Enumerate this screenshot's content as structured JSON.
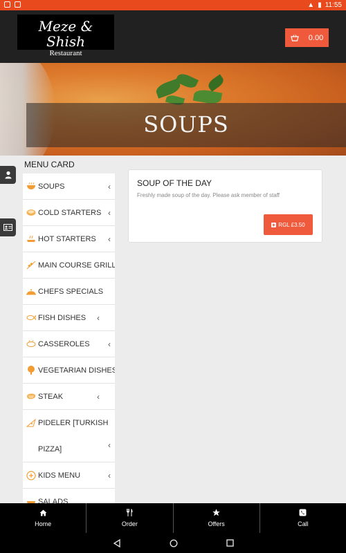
{
  "status": {
    "time": "11:55"
  },
  "header": {
    "logo_line1": "Meze & Shish",
    "logo_line2": "Restaurant",
    "cart_total": "0.00"
  },
  "banner": {
    "title": "SOUPS"
  },
  "menu": {
    "title": "MENU CARD",
    "items": [
      {
        "label": "SOUPS",
        "icon": "bowl-icon"
      },
      {
        "label": "COLD STARTERS",
        "icon": "bowl-icon"
      },
      {
        "label": "HOT STARTERS",
        "icon": "hot-dish-icon"
      },
      {
        "label": "MAIN COURSE GRILL",
        "icon": "skewer-icon"
      },
      {
        "label": "CHEFS SPECIALS",
        "icon": "cloche-icon"
      },
      {
        "label": "FISH DISHES",
        "icon": "fish-icon"
      },
      {
        "label": "CASSEROLES",
        "icon": "casserole-icon"
      },
      {
        "label": "VEGETARIAN DISHES",
        "icon": "broccoli-icon"
      },
      {
        "label": "STEAK",
        "icon": "steak-icon"
      },
      {
        "label": "PIDELER [TURKISH PIZZA]",
        "icon": "pizza-icon"
      },
      {
        "label": "KIDS MENU",
        "icon": "plus-circle-icon"
      },
      {
        "label": "SALADS",
        "icon": "salad-icon"
      }
    ]
  },
  "card": {
    "title": "SOUP OF THE DAY",
    "description": "Freshly made soup of the day. Please ask member of staff",
    "price_button": "RGL £3.50"
  },
  "bottom_nav": {
    "home": "Home",
    "order": "Order",
    "offers": "Offers",
    "call": "Call"
  },
  "colors": {
    "accent": "#f05a3c",
    "statusbar": "#e8491d",
    "header": "#212121",
    "nav": "#000000"
  }
}
